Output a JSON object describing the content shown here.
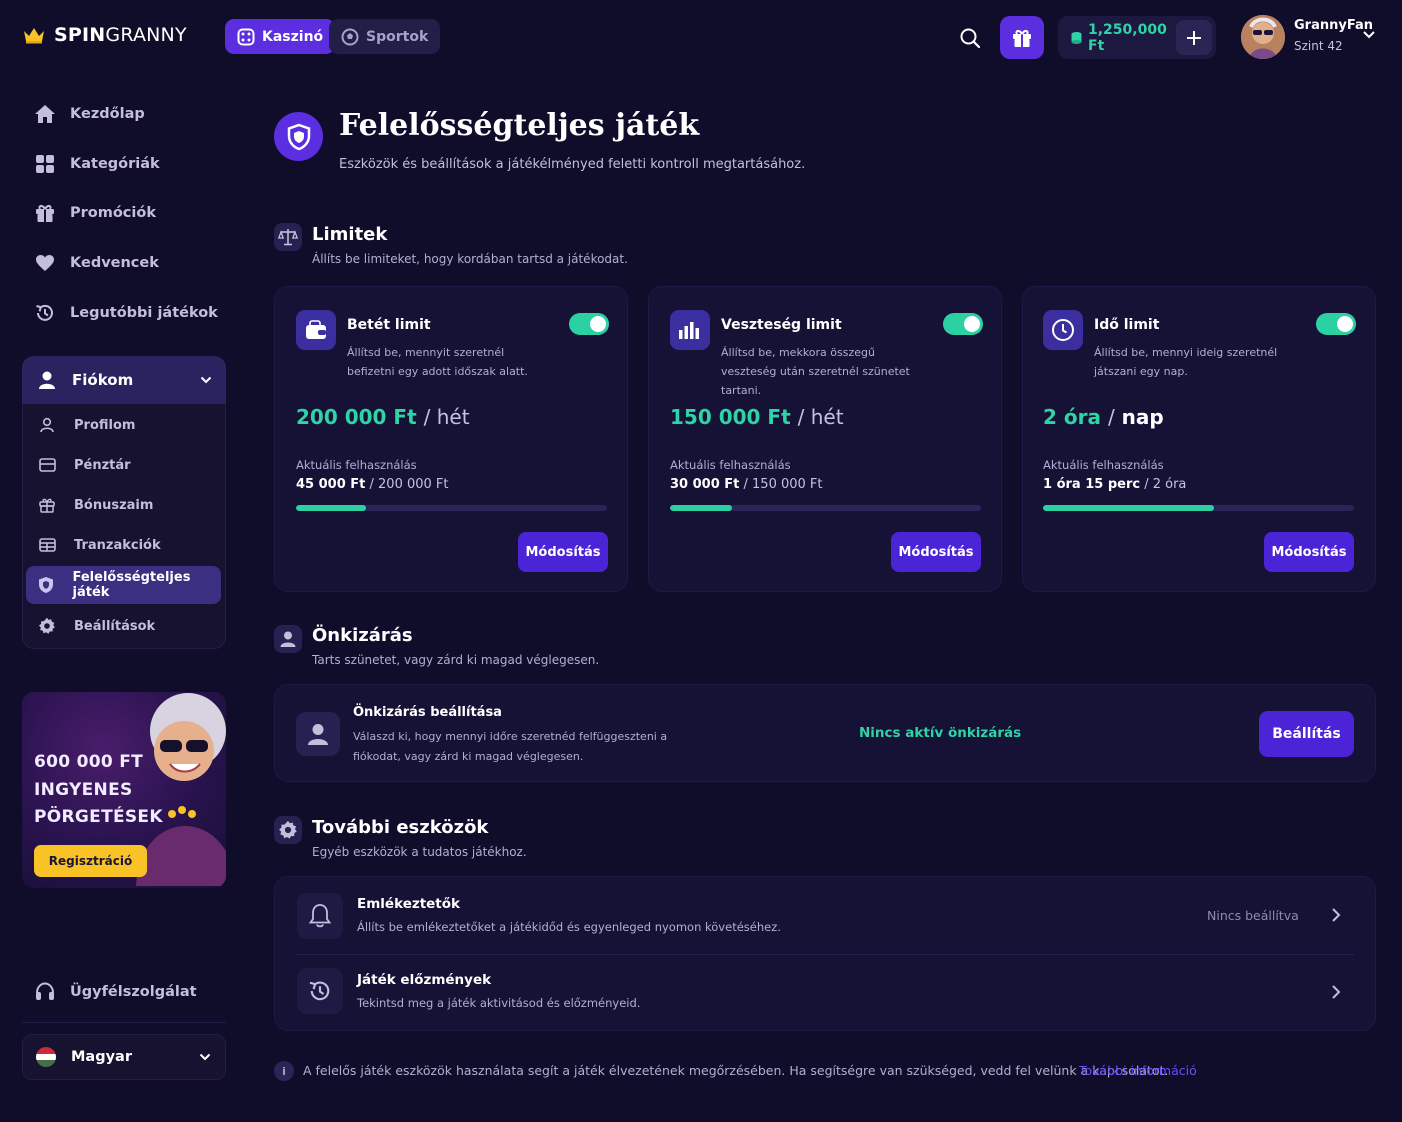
{
  "brand": {
    "name_bold": "SPIN",
    "name_regular": "GRANNY"
  },
  "topnav": {
    "casino": "Kaszinó",
    "sports": "Sportok"
  },
  "wallet": {
    "balance": "1,250,000 Ft"
  },
  "user": {
    "name": "GrannyFan",
    "level": "Szint 42"
  },
  "sidebar": {
    "items": [
      {
        "label": "Kezdőlap",
        "icon": "home-icon"
      },
      {
        "label": "Kategóriák",
        "icon": "grid-icon"
      },
      {
        "label": "Promóciók",
        "icon": "gift-icon"
      },
      {
        "label": "Kedvencek",
        "icon": "heart-icon"
      },
      {
        "label": "Legutóbbi játékok",
        "icon": "history-icon"
      }
    ],
    "account": {
      "label": "Fiókom",
      "items": [
        {
          "label": "Profilom",
          "icon": "user-icon"
        },
        {
          "label": "Pénztár",
          "icon": "wallet-icon"
        },
        {
          "label": "Bónuszaim",
          "icon": "gift-icon"
        },
        {
          "label": "Tranzakciók",
          "icon": "transactions-icon"
        },
        {
          "label": "Felelősségteljes játék",
          "icon": "shield-icon",
          "active": true
        },
        {
          "label": "Beállítások",
          "icon": "gear-icon"
        }
      ]
    },
    "promo": {
      "line1": "600 000 FT",
      "line2": "INGYENES",
      "line3": "PÖRGETÉSEK",
      "button": "Regisztráció"
    },
    "support": "Ügyfélszolgálat",
    "language": "Magyar"
  },
  "page": {
    "title": "Felelősségteljes játék",
    "subtitle": "Eszközök és beállítások a játékélményed feletti kontroll megtartásához."
  },
  "limits": {
    "title": "Limitek",
    "subtitle": "Állíts be limiteket, hogy kordában tartsd a játékodat.",
    "cards": [
      {
        "title": "Betét limit",
        "desc": "Állítsd be, mennyit szeretnél befizetni egy adott időszak alatt.",
        "value": "200 000 Ft",
        "period": "/ hét",
        "usage_label": "Aktuális felhasználás",
        "usage_current": "45 000 Ft",
        "usage_total": "/ 200 000 Ft",
        "progress": 0.225,
        "enabled": true,
        "button": "Módosítás"
      },
      {
        "title": "Veszteség limit",
        "desc": "Állítsd be, mekkora összegű veszteség után szeretnél szünetet tartani.",
        "value": "150 000 Ft",
        "period": "/ hét",
        "usage_label": "Aktuális felhasználás",
        "usage_current": "30 000 Ft",
        "usage_total": "/ 150 000 Ft",
        "progress": 0.2,
        "enabled": true,
        "button": "Módosítás"
      },
      {
        "title": "Idő limit",
        "desc": "Állítsd be, mennyi ideig szeretnél játszani egy nap.",
        "value": "2 óra",
        "period_sep": "/",
        "period_word": "nap",
        "usage_label": "Aktuális felhasználás",
        "usage_current": "1 óra 15 perc",
        "usage_total": "/ 2 óra",
        "progress": 0.55,
        "enabled": true,
        "button": "Módosítás"
      }
    ]
  },
  "self_exclusion": {
    "title": "Önkizárás",
    "subtitle": "Tarts szünetet, vagy zárd ki magad véglegesen.",
    "box_title": "Önkizárás beállítása",
    "box_desc": "Válaszd ki, hogy mennyi időre szeretnéd felfüggeszteni a fiókodat, vagy zárd ki magad véglegesen.",
    "status": "Nincs aktív önkizárás",
    "button": "Beállítás"
  },
  "tools": {
    "title": "További eszközök",
    "subtitle": "Egyéb eszközök a tudatos játékhoz.",
    "items": [
      {
        "title": "Emlékeztetők",
        "desc": "Állíts be emlékeztetőket a játékidőd és egyenleged nyomon követéséhez.",
        "status": "Nincs beállítva"
      },
      {
        "title": "Játék előzmények",
        "desc": "Tekintsd meg a játék aktivitásod és előzményeid.",
        "status": ""
      }
    ]
  },
  "footer": {
    "text": "A felelős játék eszközök használata segít a játék élvezetének megőrzésében. Ha segítségre van szükséged, vedd fel velünk a kapcsolatot.",
    "link": "További információ"
  },
  "colors": {
    "accent": "#5b2ee0",
    "success": "#2ed3a6",
    "background": "#100d2b",
    "promo_button": "#f9c327"
  }
}
